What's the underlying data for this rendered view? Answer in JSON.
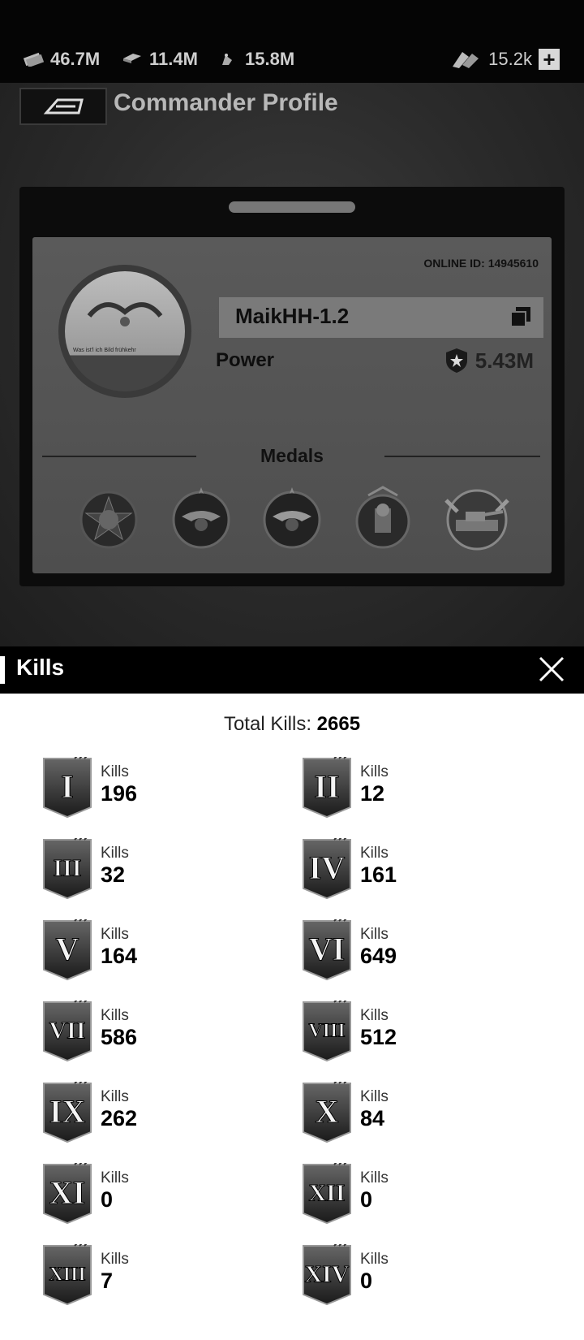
{
  "resources": [
    {
      "icon": "cash-icon",
      "value": "46.7M"
    },
    {
      "icon": "steel-icon",
      "value": "11.4M"
    },
    {
      "icon": "oil-icon",
      "value": "15.8M"
    }
  ],
  "gold": {
    "icon": "gold-icon",
    "value": "15.2k",
    "add_label": "+"
  },
  "page_title": "Commander Profile",
  "profile": {
    "online_id": "ONLINE ID: 14945610",
    "avatar_caption": "Was ist'l ich Bild frühkehr",
    "name": "MaikHH-1.2",
    "power_label": "Power",
    "power_value": "5.43M",
    "medals_title": "Medals",
    "medals": [
      "medal-star-icon",
      "medal-eagle-icon",
      "medal-eagle-icon",
      "medal-sphinx-icon",
      "medal-tank-icon"
    ]
  },
  "kills": {
    "title": "Kills",
    "close_label": "X",
    "total_label": "Total Kills: ",
    "total_value": "2665",
    "tiers": [
      {
        "numeral": "I",
        "label": "Kills",
        "value": "196"
      },
      {
        "numeral": "II",
        "label": "Kills",
        "value": "12"
      },
      {
        "numeral": "III",
        "label": "Kills",
        "value": "32"
      },
      {
        "numeral": "IV",
        "label": "Kills",
        "value": "161"
      },
      {
        "numeral": "V",
        "label": "Kills",
        "value": "164"
      },
      {
        "numeral": "VI",
        "label": "Kills",
        "value": "649"
      },
      {
        "numeral": "VII",
        "label": "Kills",
        "value": "586"
      },
      {
        "numeral": "VIII",
        "label": "Kills",
        "value": "512"
      },
      {
        "numeral": "IX",
        "label": "Kills",
        "value": "262"
      },
      {
        "numeral": "X",
        "label": "Kills",
        "value": "84"
      },
      {
        "numeral": "XI",
        "label": "Kills",
        "value": "0"
      },
      {
        "numeral": "XII",
        "label": "Kills",
        "value": "0"
      },
      {
        "numeral": "XIII",
        "label": "Kills",
        "value": "7"
      },
      {
        "numeral": "XIV",
        "label": "Kills",
        "value": "0"
      }
    ]
  }
}
